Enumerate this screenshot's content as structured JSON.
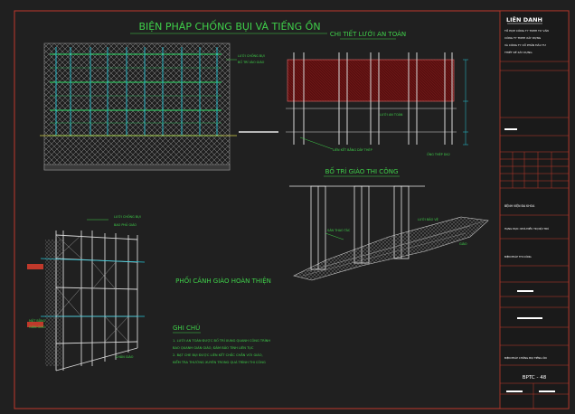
{
  "drawing": {
    "title": "BIỆN PHÁP CHỐNG BỤI VÀ TIẾNG ỒN",
    "net_detail_title": "CHI TIẾT LƯỚI AN TOÀN",
    "layout_title": "BỐ TRÍ GIÀO THI CÔNG",
    "perspective_title": "PHỐI CẢNH GIÀO HOÀN THIỆN",
    "notes_title": "GHI CHÚ",
    "notes": [
      "1. LƯỚI AN TOÀN ĐƯỢC BỐ TRÍ XUNG QUANH CÔNG TRÌNH",
      "BAO QUANH GIÀN GIÁO, ĐẢM BẢO TÍNH LIÊN TỤC",
      "2. BẠT CHE BỤI ĐƯỢC LIÊN KẾT CHẮC CHẮN VỚI GIÀO,",
      "KIỂM TRA THƯỜNG XUYÊN TRONG QUÁ TRÌNH THI CÔNG"
    ],
    "callouts": {
      "elev_net": "LƯỚI CHỐNG BỤI",
      "elev_net2": "BỐ TRÍ VÀO GIÀO",
      "net_scaff": "LƯỚI AN TOÀN",
      "net_tie": "LIÊN KẾT BẰNG DÂY THÉP",
      "net_pipe": "ỐNG THÉP D42",
      "layout_net": "LƯỚI BẢO VỆ",
      "layout_bar": "SÀN THAO TÁC",
      "layout_wall": "GIÀO",
      "p_net": "LƯỚI CHỐNG BỤI",
      "p_net2": "BAO PHỦ GIÀO",
      "p_side": "MẶT BẰNG",
      "p_side2": "GIÀN GIÁO",
      "p_base": "CHÂN GIÀO"
    },
    "title_block": {
      "company": "LIÊN DANH",
      "company_lines": [
        "TỔ HỢP CÔNG TY TNHH TƯ VẤN",
        "CÔNG TY TNHH XÂY DỰNG",
        "VÀ CÔNG TY CỔ PHẦN ĐẦU TƯ",
        "THIẾT KẾ XÂY DỰNG"
      ],
      "project": "BỆNH VIỆN ĐA KHOA",
      "item": "HẠNG MỤC: NHÀ ĐIỀU TRỊ NỘI TRÚ",
      "item2": "BIỆN PHÁP THI CÔNG",
      "sheet_name": "BIỆN PHÁP CHỐNG BỤI TIẾNG ỒN",
      "sheet_no": "BPTC - 48"
    }
  }
}
